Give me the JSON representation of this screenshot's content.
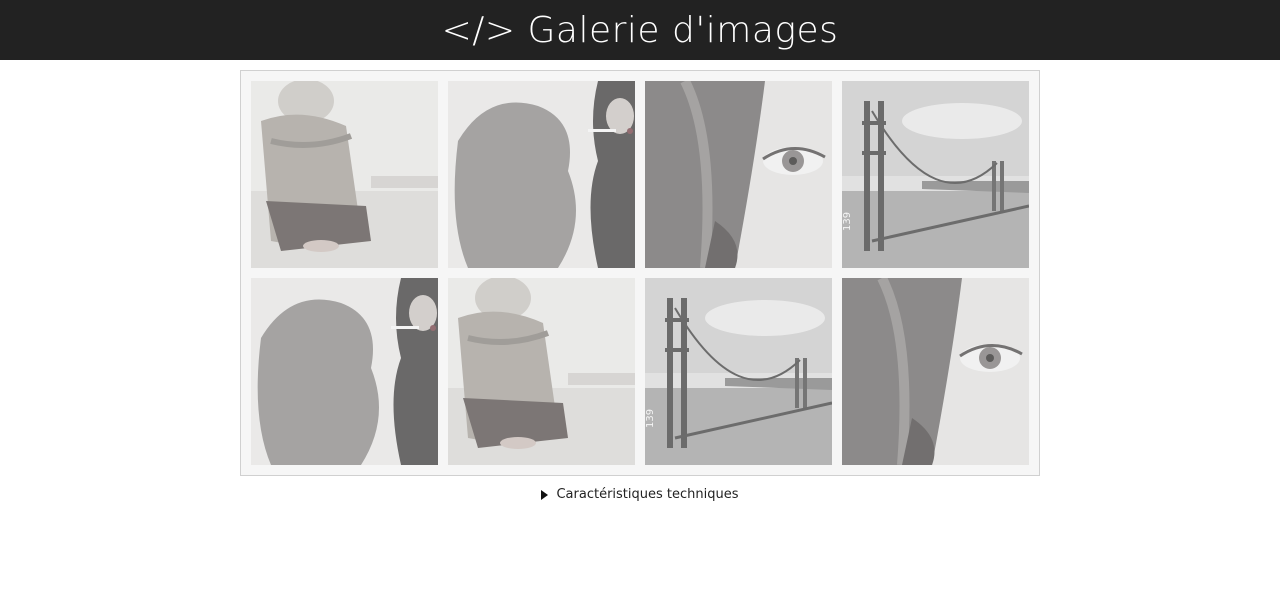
{
  "header": {
    "title": "</> Galerie d'images"
  },
  "gallery": {
    "images": [
      {
        "name": "woman-sitting-photo"
      },
      {
        "name": "woman-smoking-shadow-photo"
      },
      {
        "name": "woman-eye-closeup-photo"
      },
      {
        "name": "golden-gate-bridge-photo",
        "label": "139"
      },
      {
        "name": "woman-smoking-shadow-photo"
      },
      {
        "name": "woman-sitting-photo"
      },
      {
        "name": "golden-gate-bridge-photo",
        "label": "139"
      },
      {
        "name": "woman-eye-closeup-photo"
      }
    ]
  },
  "details": {
    "summary": "Caractéristiques techniques"
  }
}
